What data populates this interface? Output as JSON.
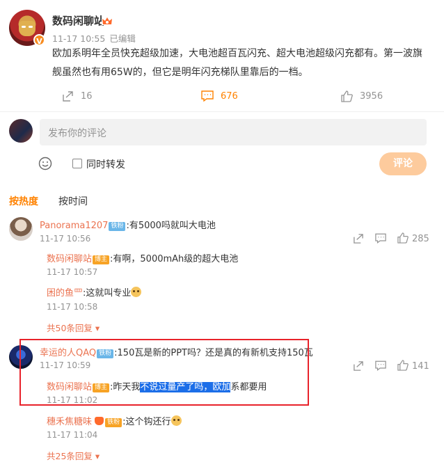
{
  "post": {
    "author": "数码闲聊站",
    "verified_badge": "V",
    "time": "11-17 10:55",
    "edited": "已编辑",
    "content": "欧加系明年全员快充超级加速，大电池超百瓦闪充、超大电池超级闪充都有。第一波旗舰虽然也有用65W的，但它是明年闪充梯队里靠后的一档。",
    "reposts": "16",
    "comments": "676",
    "likes": "3956"
  },
  "composer": {
    "placeholder": "发布你的评论",
    "repost_label": "同时转发",
    "submit_label": "评论"
  },
  "tabs": {
    "hot": "按热度",
    "time": "按时间"
  },
  "comments": [
    {
      "name": "Panorama1207",
      "badge": "铁粉",
      "text": ":有5000吗就叫大电池",
      "time": "11-17 10:56",
      "likes": "285",
      "replies": [
        {
          "name": "数码闲聊站",
          "badge": "博主",
          "text": ":有啊，5000mAh级的超大电池",
          "time": "11-17 10:57"
        },
        {
          "name": "困的鱼罒",
          "text": ":这就叫专业",
          "time": "11-17 10:58"
        }
      ],
      "more": "共50条回复"
    },
    {
      "name": "幸运的人QAQ",
      "badge": "铁粉",
      "text": ":150瓦是新的PPT吗？还是真的有新机支持150瓦",
      "time": "11-17 10:59",
      "likes": "141",
      "replies": [
        {
          "name": "数码闲聊站",
          "badge": "博主",
          "text_pre": ":昨天我",
          "text_hl": "不说过量产了吗，欧加",
          "text_post": "系都要用",
          "time": "11-17 11:02"
        },
        {
          "name": "穗禾焦糖味",
          "badge": "铁粉",
          "text": ":这个钩还行",
          "time": "11-17 11:04"
        }
      ],
      "more": "共25条回复"
    }
  ],
  "colors": {
    "accent": "#ff8200",
    "link": "#eb7350",
    "highlight": "#1c6ee8",
    "annotation_box": "#e8222a"
  }
}
